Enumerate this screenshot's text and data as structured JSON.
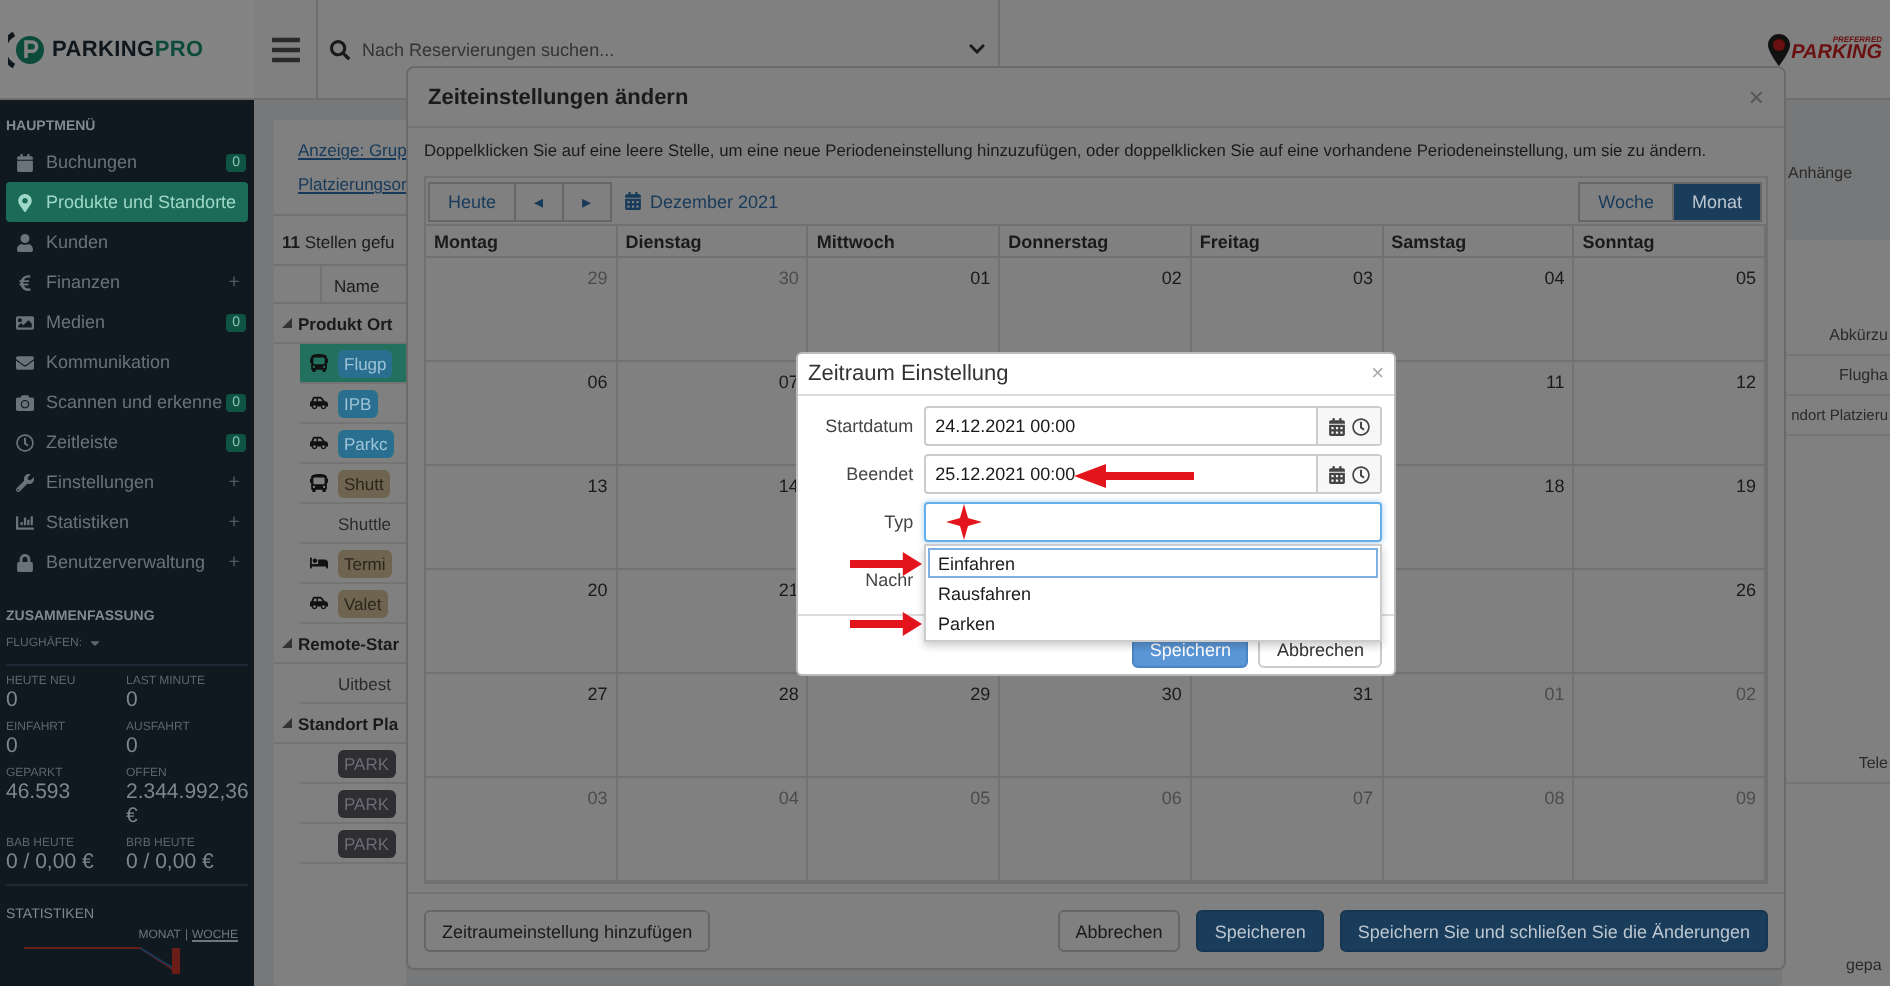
{
  "sidebar": {
    "logo": {
      "word": "PARKING",
      "accent": "PRO"
    },
    "main_menu_title": "HAUPTMENÜ",
    "menu": [
      {
        "label": "Buchungen",
        "selected": false,
        "badge": "0"
      },
      {
        "label": "Produkte und Standorte",
        "selected": true
      },
      {
        "label": "Kunden",
        "selected": false
      },
      {
        "label": "Finanzen",
        "selected": false,
        "expand": "+"
      },
      {
        "label": "Medien",
        "selected": false,
        "badge": "0"
      },
      {
        "label": "Kommunikation",
        "selected": false
      },
      {
        "label": "Scannen und erkenne",
        "selected": false,
        "badge": "0"
      },
      {
        "label": "Zeitleiste",
        "selected": false,
        "badge": "0"
      },
      {
        "label": "Einstellungen",
        "selected": false,
        "expand": "+"
      },
      {
        "label": "Statistiken",
        "selected": false,
        "expand": "+"
      },
      {
        "label": "Benutzerverwaltung",
        "selected": false,
        "expand": "+"
      }
    ],
    "summary_title": "ZUSAMMENFASSUNG",
    "filter": "FLUGHÄFEN:",
    "stats": [
      {
        "label": "HEUTE NEU",
        "value": "0"
      },
      {
        "label": "LAST MINUTE",
        "value": "0"
      },
      {
        "label": "EINFAHRT",
        "value": "0"
      },
      {
        "label": "AUSFAHRT",
        "value": "0"
      },
      {
        "label": "GEPARKT",
        "value": "46.593"
      },
      {
        "label": "OFFEN",
        "value": "2.344.992,36 €"
      },
      {
        "label": "BAB HEUTE",
        "value": "0 / 0,00 €"
      },
      {
        "label": "BRB HEUTE",
        "value": "0 / 0,00 €"
      }
    ],
    "statistics_title": "STATISTIKEN",
    "periods": [
      {
        "label": "MONAT",
        "selected": true
      },
      {
        "label": "WOCHE",
        "selected": false
      }
    ],
    "period_separator": "|"
  },
  "topbar": {
    "search": {
      "placeholder": "Nach Reservierungen suchen..."
    },
    "brand": {
      "small": "PREFERRED",
      "word": "PARKING"
    }
  },
  "background": {
    "links": [
      "Anzeige: Grup",
      "Platzierungsor"
    ],
    "count": "**11** Stellen gefu",
    "name_column": "Name",
    "groups": [
      {
        "title": "Produkt Ort",
        "expanded": true,
        "rows": [
          {
            "kind": "tag",
            "text": "Flugp",
            "color": "#2a6f90",
            "selected": true
          },
          {
            "kind": "tag",
            "text": "IPB",
            "color": "#2a6f90",
            "selected": false
          },
          {
            "kind": "tag",
            "text": "Parkc",
            "color": "#2a6f90",
            "selected": false
          },
          {
            "kind": "tag",
            "text": "Shutt",
            "color": "#6e6450",
            "selected": false
          },
          {
            "kind": "text",
            "text": "Shuttle",
            "selected": false
          },
          {
            "kind": "tag",
            "text": "Termi",
            "color": "#6e6450",
            "selected": false
          },
          {
            "kind": "tag",
            "text": "Valet",
            "color": "#6e6450",
            "selected": false
          }
        ]
      },
      {
        "title": "Remote-Star",
        "expanded": true,
        "rows": [
          {
            "kind": "text",
            "text": "Uitbest",
            "selected": false
          }
        ]
      },
      {
        "title": "Standort Pla",
        "expanded": true,
        "rows": [
          {
            "kind": "tag",
            "text": "PARK",
            "color": "#2e2e33",
            "selected": false
          },
          {
            "kind": "tag",
            "text": "PARK",
            "color": "#2e2e33",
            "selected": false
          },
          {
            "kind": "tag",
            "text": "PARK",
            "color": "#2e2e33",
            "selected": false
          }
        ]
      }
    ],
    "attachments_label": "Anhänge",
    "right_cells": [
      "Abkürzu",
      "Flugha",
      "ndort Platzieru",
      "Tele"
    ],
    "bottom_text": "gepa"
  },
  "dialog": {
    "title": "Zeiteinstellungen ändern",
    "close": "×",
    "hint": "Doppelklicken Sie auf eine leere Stelle, um eine neue Periodeneinstellung hinzuzufügen, oder doppelklicken Sie auf eine vorhandene Periodeneinstellung, um sie zu ändern.",
    "today": "Heute",
    "prev": "◂",
    "next": "▸",
    "month": "Dezember 2021",
    "views": [
      {
        "label": "Woche",
        "selected": false
      },
      {
        "label": "Monat",
        "selected": true
      }
    ],
    "weekdays": [
      "Montag",
      "Dienstag",
      "Mittwoch",
      "Donnerstag",
      "Freitag",
      "Samstag",
      "Sonntag"
    ],
    "weeks": [
      {
        "start": [
          {
            "day": "29",
            "outside": true
          },
          {
            "day": "30",
            "outside": true
          },
          {
            "day": "01",
            "outside": false
          },
          {
            "day": "02",
            "outside": false
          },
          {
            "day": "03",
            "outside": false
          },
          {
            "day": "04",
            "outside": false
          },
          {
            "day": "05",
            "outside": false
          }
        ]
      },
      {
        "start": [
          {
            "day": "06",
            "outside": false
          },
          {
            "day": "07",
            "outside": false
          }
        ],
        "end": [
          {
            "day": "11",
            "outside": false
          },
          {
            "day": "12",
            "outside": false
          }
        ]
      },
      {
        "start": [
          {
            "day": "13",
            "outside": false
          },
          {
            "day": "14",
            "outside": false
          }
        ],
        "end": [
          {
            "day": "18",
            "outside": false
          },
          {
            "day": "19",
            "outside": false
          }
        ]
      },
      {
        "start": [
          {
            "day": "20",
            "outside": false
          },
          {
            "day": "21",
            "outside": false
          }
        ],
        "end": [
          {
            "day": "26",
            "outside": false
          }
        ]
      },
      {
        "start": [
          {
            "day": "27",
            "outside": false
          },
          {
            "day": "28",
            "outside": false
          },
          {
            "day": "29",
            "outside": false
          },
          {
            "day": "30",
            "outside": false
          },
          {
            "day": "31",
            "outside": false
          },
          {
            "day": "01",
            "outside": true
          },
          {
            "day": "02",
            "outside": true
          }
        ]
      },
      {
        "start": [
          {
            "day": "03",
            "outside": true
          },
          {
            "day": "04",
            "outside": true
          },
          {
            "day": "05",
            "outside": true
          },
          {
            "day": "06",
            "outside": true
          },
          {
            "day": "07",
            "outside": true
          },
          {
            "day": "08",
            "outside": true
          },
          {
            "day": "09",
            "outside": true
          }
        ]
      }
    ],
    "add_button": "Zeitraumeinstellung hinzufügen",
    "buttons": [
      {
        "label": "Abbrechen",
        "kind": "default"
      },
      {
        "label": "Speicheren",
        "kind": "primary"
      },
      {
        "label": "Speichern Sie und schließen Sie die Änderungen",
        "kind": "primary"
      }
    ]
  },
  "period_dialog": {
    "title": "Zeitraum Einstellung",
    "close": "×",
    "fields": [
      {
        "label": "Startdatum",
        "kind": "datetime",
        "value": "24.12.2021 00:00"
      },
      {
        "label": "Beendet",
        "kind": "datetime",
        "value": "25.12.2021 00:00",
        "annotation": {
          "kind": "arrow"
        }
      },
      {
        "label": "Typ",
        "kind": "select",
        "focused": true,
        "annotation": {
          "kind": "star"
        }
      },
      {
        "label": "Nachr",
        "kind": "text"
      }
    ],
    "options": [
      {
        "label": "Einfahren",
        "selected": true,
        "annotation": {
          "kind": "arrow"
        }
      },
      {
        "label": "Rausfahren",
        "selected": false
      },
      {
        "label": "Parken",
        "selected": false,
        "annotation": {
          "kind": "arrow"
        }
      }
    ],
    "buttons": [
      {
        "label": "Speichern",
        "kind": "primary"
      },
      {
        "label": "Abbrechen",
        "kind": "default"
      }
    ]
  }
}
